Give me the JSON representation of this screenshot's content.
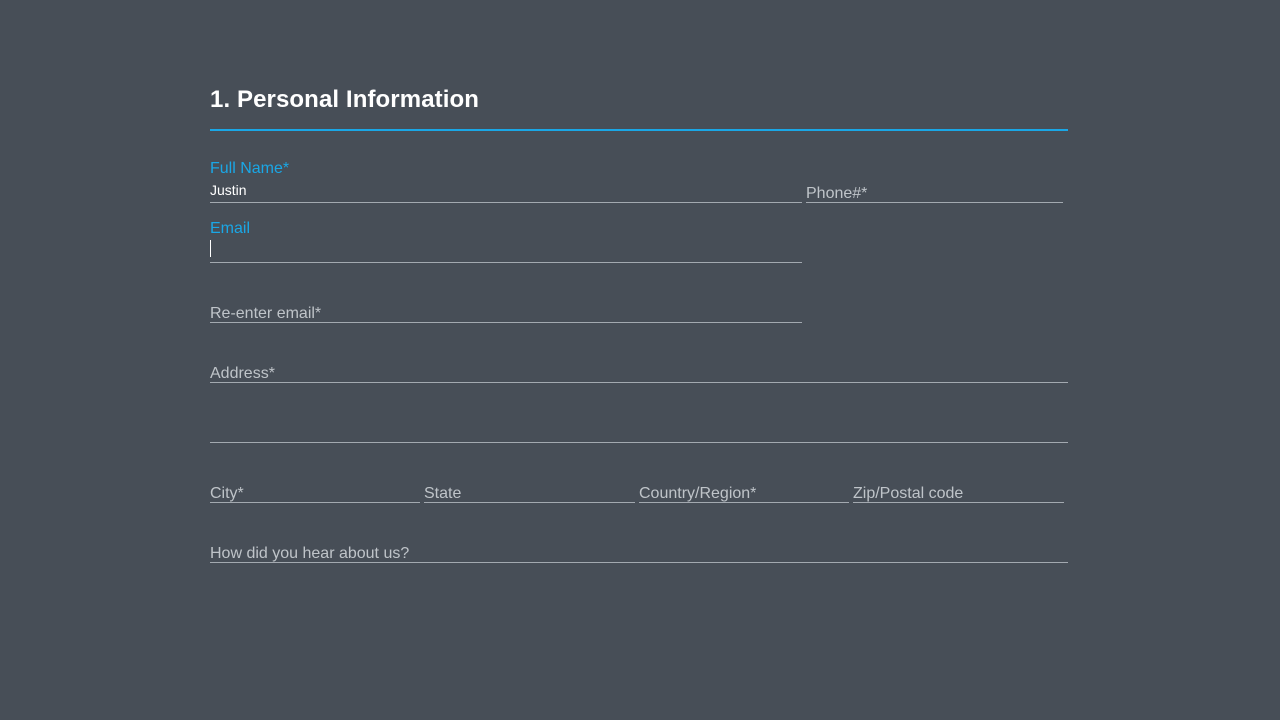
{
  "section": {
    "title": "1. Personal Information"
  },
  "fields": {
    "full_name": {
      "label": "Full Name*",
      "value": "Justin"
    },
    "phone": {
      "placeholder": "Phone#*"
    },
    "email": {
      "label": "Email",
      "value": ""
    },
    "reenter_email": {
      "placeholder": "Re-enter email*"
    },
    "address": {
      "placeholder": "Address*"
    },
    "address_line_2": {
      "placeholder": ""
    },
    "city": {
      "placeholder": "City*"
    },
    "state": {
      "placeholder": "State"
    },
    "country": {
      "placeholder": "Country/Region*"
    },
    "zip": {
      "placeholder": "Zip/Postal code"
    },
    "referral": {
      "placeholder": "How did you hear about us?"
    }
  },
  "colors": {
    "background": "#474e57",
    "accent": "#1aa7e6",
    "line": "#a3a9b0",
    "placeholder": "#bfc4c9",
    "text": "#ffffff"
  }
}
